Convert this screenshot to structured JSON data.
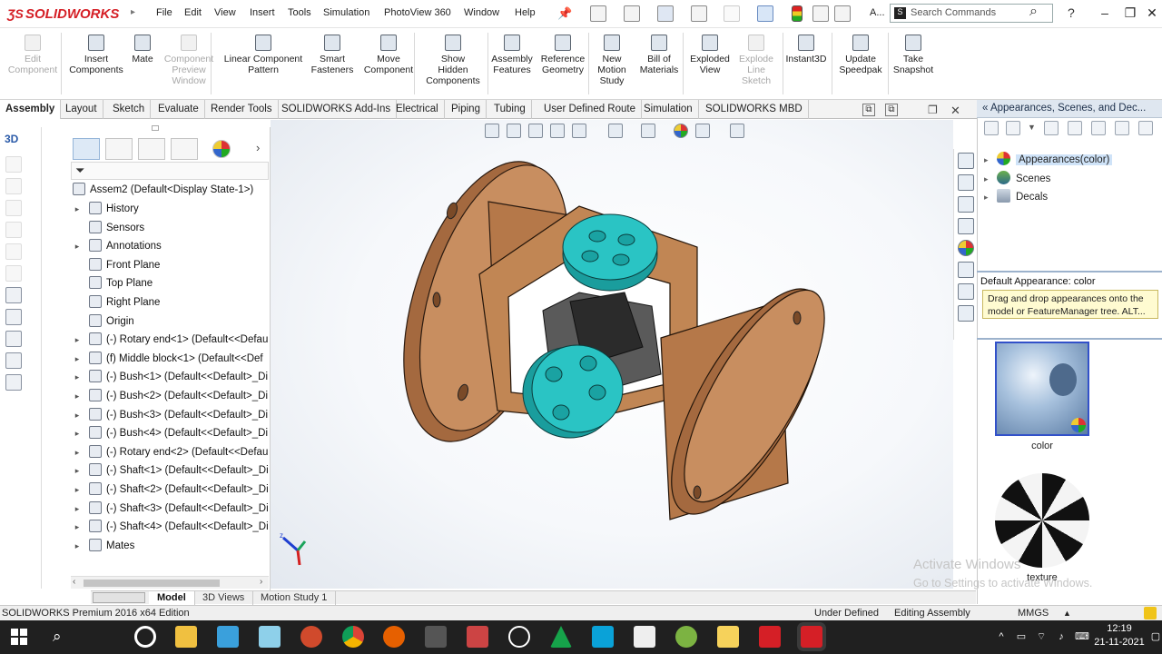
{
  "app": {
    "brand": "SOLIDWORKS",
    "menu": [
      "File",
      "Edit",
      "View",
      "Insert",
      "Tools",
      "Simulation",
      "PhotoView 360",
      "Window",
      "Help"
    ],
    "search_placeholder": "Search Commands",
    "help_label": "?",
    "overflow_label": "A..."
  },
  "ribbon": {
    "buttons": [
      {
        "label": "Edit\nComponent",
        "enabled": false,
        "icon": "edit-component-icon"
      },
      {
        "label": "Insert\nComponents",
        "enabled": true,
        "icon": "insert-components-icon"
      },
      {
        "label": "Mate",
        "enabled": true,
        "icon": "mate-icon"
      },
      {
        "label": "Component\nPreview\nWindow",
        "enabled": false,
        "icon": "component-preview-icon"
      },
      {
        "label": "Linear Component\nPattern",
        "enabled": true,
        "icon": "linear-pattern-icon"
      },
      {
        "label": "Smart\nFasteners",
        "enabled": true,
        "icon": "smart-fasteners-icon"
      },
      {
        "label": "Move\nComponent",
        "enabled": true,
        "icon": "move-component-icon"
      },
      {
        "label": "Show\nHidden\nComponents",
        "enabled": true,
        "icon": "show-hidden-icon"
      },
      {
        "label": "Assembly\nFeatures",
        "enabled": true,
        "icon": "assembly-features-icon"
      },
      {
        "label": "Reference\nGeometry",
        "enabled": true,
        "icon": "reference-geometry-icon"
      },
      {
        "label": "New\nMotion\nStudy",
        "enabled": true,
        "icon": "motion-study-icon"
      },
      {
        "label": "Bill of\nMaterials",
        "enabled": true,
        "icon": "bom-icon"
      },
      {
        "label": "Exploded\nView",
        "enabled": true,
        "icon": "exploded-view-icon"
      },
      {
        "label": "Explode\nLine\nSketch",
        "enabled": false,
        "icon": "explode-line-icon"
      },
      {
        "label": "Instant3D",
        "enabled": true,
        "icon": "instant3d-icon"
      },
      {
        "label": "Update\nSpeedpak",
        "enabled": true,
        "icon": "speedpak-icon"
      },
      {
        "label": "Take\nSnapshot",
        "enabled": true,
        "icon": "camera-icon"
      }
    ]
  },
  "tabs": [
    "Assembly",
    "Layout",
    "Sketch",
    "Evaluate",
    "Render Tools",
    "SOLIDWORKS Add-Ins",
    "Electrical",
    "Piping",
    "Tubing",
    "User Defined Route",
    "Simulation",
    "SOLIDWORKS MBD"
  ],
  "active_tab": "Assembly",
  "feature_tree": {
    "root": "Assem2  (Default<Display State-1>)",
    "items": [
      {
        "label": "History",
        "expandable": true
      },
      {
        "label": "Sensors",
        "expandable": false
      },
      {
        "label": "Annotations",
        "expandable": true
      },
      {
        "label": "Front Plane",
        "expandable": false
      },
      {
        "label": "Top Plane",
        "expandable": false
      },
      {
        "label": "Right Plane",
        "expandable": false
      },
      {
        "label": "Origin",
        "expandable": false
      },
      {
        "label": "(-) Rotary end<1> (Default<<Defau",
        "expandable": true
      },
      {
        "label": "(f) Middle block<1> (Default<<Def",
        "expandable": true
      },
      {
        "label": "(-) Bush<1> (Default<<Default>_Di",
        "expandable": true
      },
      {
        "label": "(-) Bush<2> (Default<<Default>_Di",
        "expandable": true
      },
      {
        "label": "(-) Bush<3> (Default<<Default>_Di",
        "expandable": true
      },
      {
        "label": "(-) Bush<4> (Default<<Default>_Di",
        "expandable": true
      },
      {
        "label": "(-) Rotary end<2> (Default<<Defau",
        "expandable": true
      },
      {
        "label": "(-) Shaft<1> (Default<<Default>_Di",
        "expandable": true
      },
      {
        "label": "(-) Shaft<2> (Default<<Default>_Di",
        "expandable": true
      },
      {
        "label": "(-) Shaft<3> (Default<<Default>_Di",
        "expandable": true
      },
      {
        "label": "(-) Shaft<4> (Default<<Default>_Di",
        "expandable": true
      },
      {
        "label": "Mates",
        "expandable": true
      }
    ]
  },
  "bottom_tabs": [
    "Model",
    "3D Views",
    "Motion Study 1"
  ],
  "active_bottom_tab": "Model",
  "task_pane": {
    "title": "Appearances, Scenes, and Dec...",
    "tree": [
      {
        "label": "Appearances(color)",
        "selected": true,
        "icon": "appearances-icon"
      },
      {
        "label": "Scenes",
        "selected": false,
        "icon": "scenes-icon"
      },
      {
        "label": "Decals",
        "selected": false,
        "icon": "decals-icon"
      }
    ],
    "default_appearance": "Default Appearance: color",
    "tooltip": "Drag and drop appearances onto the model or FeatureManager tree.  ALT...",
    "swatches": [
      {
        "label": "color"
      },
      {
        "label": "texture"
      }
    ]
  },
  "watermark": {
    "line1": "Activate Windows",
    "line2": "Go to Settings to activate Windows."
  },
  "status": {
    "product": "SOLIDWORKS Premium 2016 x64 Edition",
    "state": "Under Defined",
    "mode": "Editing Assembly",
    "units": "MMGS"
  },
  "taskbar": {
    "time": "12:19",
    "date": "21-11-2021"
  },
  "colors": {
    "brand": "#d51f26",
    "body": "#c48a5c",
    "bush": "#2ac4c4",
    "accent": "#3251c9"
  }
}
